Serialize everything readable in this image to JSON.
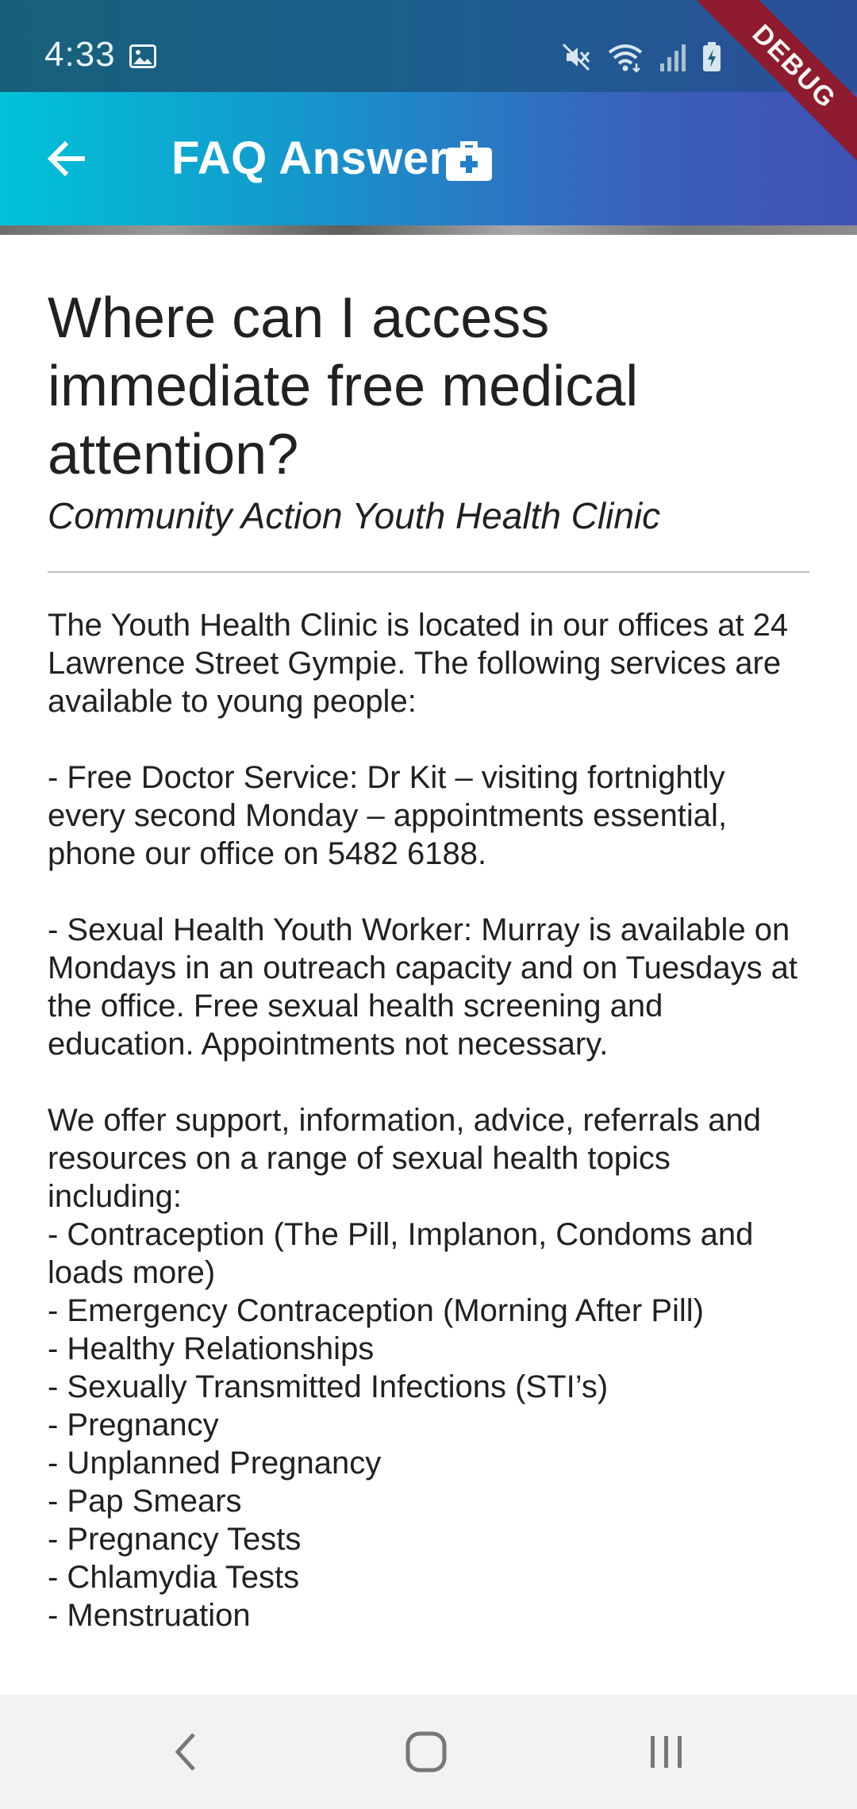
{
  "status_bar": {
    "time": "4:33",
    "icons": [
      "gallery-icon",
      "mute-icon",
      "wifi-icon",
      "signal-icon",
      "battery-charging-icon"
    ]
  },
  "debug_banner": "DEBUG",
  "app_bar": {
    "title": "FAQ Answer",
    "back_icon": "back-arrow-icon",
    "title_icon": "medical-kit-icon",
    "gradient": [
      "#00c2d8",
      "#3f51b5"
    ]
  },
  "faq": {
    "question": "Where can I access immediate free medical attention?",
    "source": "Community Action Youth Health Clinic",
    "answer": "The Youth Health Clinic is located in our offices at 24 Lawrence Street Gympie. The following services are available to young people:\n\n- Free Doctor Service:  Dr Kit – visiting fortnightly every second Monday – appointments essential, phone our office on 5482 6188.\n\n- Sexual Health Youth Worker:  Murray is available on Mondays in an outreach capacity and on Tuesdays at the office.  Free sexual health screening and education.  Appointments not necessary.\n\nWe offer support, information, advice, referrals and resources on a range of sexual health topics including:\n- Contraception (The Pill, Implanon, Condoms and loads more)\n- Emergency Contraception (Morning After Pill)\n- Healthy Relationships\n- Sexually Transmitted Infections (STI’s)\n- Pregnancy\n- Unplanned Pregnancy\n- Pap Smears\n- Pregnancy Tests\n- Chlamydia Tests\n- Menstruation"
  },
  "nav_bar": {
    "buttons": [
      "nav-back-icon",
      "nav-home-icon",
      "nav-recents-icon"
    ]
  }
}
